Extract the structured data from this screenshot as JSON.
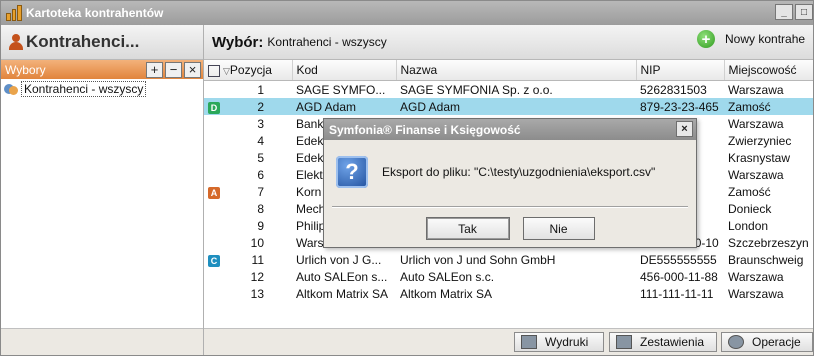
{
  "window": {
    "title": "Kartoteka kontrahentów",
    "controls": [
      "_",
      "□",
      "×"
    ]
  },
  "left_panel": {
    "header": "Kontrahenci...",
    "wybory_label": "Wybory",
    "wybory_buttons": [
      "+",
      "−",
      "×"
    ],
    "tree_items": [
      {
        "label": "Kontrahenci - wszyscy",
        "icon": "users-icon"
      }
    ]
  },
  "right_panel": {
    "wybor_label": "Wybór:",
    "wybor_value": "Kontrahenci - wszyscy",
    "new_button_label": "Nowy kontrahe",
    "columns": [
      "Pozycja",
      "Kod",
      "Nazwa",
      "NIP",
      "Miejscowość"
    ],
    "rows": [
      {
        "badge": "",
        "badge_color": "",
        "pos": "1",
        "kod": "SAGE SYMFO...",
        "nazwa": "SAGE SYMFONIA Sp. z o.o.",
        "nip": "5262831503",
        "miejsc": "Warszawa"
      },
      {
        "badge": "D",
        "badge_color": "#2aa85a",
        "pos": "2",
        "kod": "AGD Adam",
        "nazwa": "AGD Adam",
        "nip": "879-23-23-465",
        "miejsc": "Zamość",
        "selected": true
      },
      {
        "badge": "",
        "badge_color": "",
        "pos": "3",
        "kod": "Bank",
        "nazwa": "",
        "nip": "3-41",
        "miejsc": "Warszawa"
      },
      {
        "badge": "",
        "badge_color": "",
        "pos": "4",
        "kod": "Edek",
        "nazwa": "",
        "nip": "6-02",
        "miejsc": "Zwierzyniec"
      },
      {
        "badge": "",
        "badge_color": "",
        "pos": "5",
        "kod": "Edek",
        "nazwa": "",
        "nip": "6-02",
        "miejsc": "Krasnystaw"
      },
      {
        "badge": "",
        "badge_color": "",
        "pos": "6",
        "kod": "Elekt",
        "nazwa": "",
        "nip": "402",
        "miejsc": "Warszawa"
      },
      {
        "badge": "A",
        "badge_color": "#d5692a",
        "pos": "7",
        "kod": "Korn",
        "nazwa": "",
        "nip": "3-77",
        "miejsc": "Zamość"
      },
      {
        "badge": "",
        "badge_color": "",
        "pos": "8",
        "kod": "Mech",
        "nazwa": "",
        "nip": "963",
        "miejsc": "Donieck"
      },
      {
        "badge": "",
        "badge_color": "",
        "pos": "9",
        "kod": "Philip",
        "nazwa": "",
        "nip": "647",
        "miejsc": "London"
      },
      {
        "badge": "",
        "badge_color": "",
        "pos": "10",
        "kod": "Warski sc.",
        "nazwa": "Warski sc.",
        "nip": "725-234-10-10",
        "miejsc": "Szczebrzeszyn"
      },
      {
        "badge": "C",
        "badge_color": "#1f8fbf",
        "pos": "11",
        "kod": "Urlich von J G...",
        "nazwa": "Urlich von J und Sohn GmbH",
        "nip": "DE555555555",
        "miejsc": "Braunschweig"
      },
      {
        "badge": "",
        "badge_color": "",
        "pos": "12",
        "kod": "Auto SALEon s...",
        "nazwa": "Auto SALEon s.c.",
        "nip": "456-000-11-88",
        "miejsc": "Warszawa"
      },
      {
        "badge": "",
        "badge_color": "",
        "pos": "13",
        "kod": "Altkom Matrix SA",
        "nazwa": "Altkom Matrix SA",
        "nip": "111-111-11-11",
        "miejsc": "Warszawa"
      }
    ],
    "bottom_buttons": [
      {
        "label": "Wydruki",
        "icon": "printer-icon"
      },
      {
        "label": "Zestawienia",
        "icon": "report-icon"
      },
      {
        "label": "Operacje",
        "icon": "gear-icon"
      }
    ]
  },
  "dialog": {
    "title": "Symfonia® Finanse i Księgowość",
    "message": "Eksport do pliku: \"C:\\testy\\uzgodnienia\\eksport.csv\"",
    "icon": "question-icon",
    "yes_label": "Tak",
    "no_label": "Nie"
  }
}
